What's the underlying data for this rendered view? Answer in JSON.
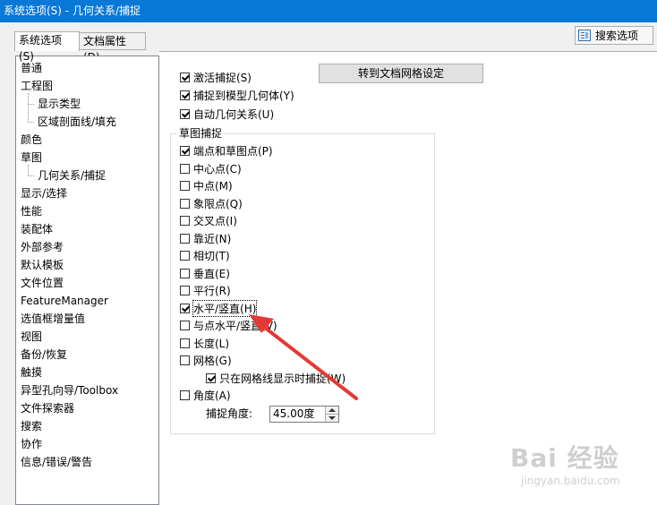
{
  "window": {
    "title": "系统选项(S) - 几何关系/捕捉"
  },
  "search_button": {
    "label": "搜索选项"
  },
  "tabs": [
    {
      "label": "系统选项(S)",
      "active": true
    },
    {
      "label": "文档属性(D)",
      "active": false
    }
  ],
  "tree": [
    {
      "label": "普通",
      "level": 0
    },
    {
      "label": "工程图",
      "level": 0
    },
    {
      "label": "显示类型",
      "level": 1
    },
    {
      "label": "区域剖面线/填充",
      "level": 1
    },
    {
      "label": "颜色",
      "level": 0
    },
    {
      "label": "草图",
      "level": 0
    },
    {
      "label": "几何关系/捕捉",
      "level": 1,
      "selected": true
    },
    {
      "label": "显示/选择",
      "level": 0
    },
    {
      "label": "性能",
      "level": 0
    },
    {
      "label": "装配体",
      "level": 0
    },
    {
      "label": "外部参考",
      "level": 0
    },
    {
      "label": "默认模板",
      "level": 0
    },
    {
      "label": "文件位置",
      "level": 0
    },
    {
      "label": "FeatureManager",
      "level": 0
    },
    {
      "label": "选值框增量值",
      "level": 0
    },
    {
      "label": "视图",
      "level": 0
    },
    {
      "label": "备份/恢复",
      "level": 0
    },
    {
      "label": "触摸",
      "level": 0
    },
    {
      "label": "异型孔向导/Toolbox",
      "level": 0
    },
    {
      "label": "文件探索器",
      "level": 0
    },
    {
      "label": "搜索",
      "level": 0
    },
    {
      "label": "协作",
      "level": 0
    },
    {
      "label": "信息/错误/警告",
      "level": 0
    }
  ],
  "top_options": [
    {
      "label": "激活捕捉(S)",
      "checked": true
    },
    {
      "label": "捕捉到模型几何体(Y)",
      "checked": true
    },
    {
      "label": "自动几何关系(U)",
      "checked": true
    }
  ],
  "grid_button": {
    "label": "转到文档网格设定"
  },
  "sketch_snaps": {
    "title": "草图捕捉",
    "items": [
      {
        "label": "端点和草图点(P)",
        "checked": true
      },
      {
        "label": "中心点(C)",
        "checked": false
      },
      {
        "label": "中点(M)",
        "checked": false
      },
      {
        "label": "象限点(Q)",
        "checked": false
      },
      {
        "label": "交叉点(I)",
        "checked": false
      },
      {
        "label": "靠近(N)",
        "checked": false
      },
      {
        "label": "相切(T)",
        "checked": false
      },
      {
        "label": "垂直(E)",
        "checked": false
      },
      {
        "label": "平行(R)",
        "checked": false
      },
      {
        "label": "水平/竖直(H)",
        "checked": true,
        "focused": true
      },
      {
        "label": "与点水平/竖直(V)",
        "checked": false
      },
      {
        "label": "长度(L)",
        "checked": false
      },
      {
        "label": "网格(G)",
        "checked": false
      }
    ],
    "grid_sub": {
      "label": "只在网格线显示时捕捉(W)",
      "checked": true
    },
    "angle": {
      "label": "角度(A)",
      "checked": false
    },
    "snap_angle": {
      "label": "捕捉角度:",
      "value": "45.00度"
    }
  },
  "annotation": {
    "color": "#e53935"
  },
  "watermark": {
    "logo": "Bai 经验",
    "url": "jingyan.baidu.com"
  }
}
